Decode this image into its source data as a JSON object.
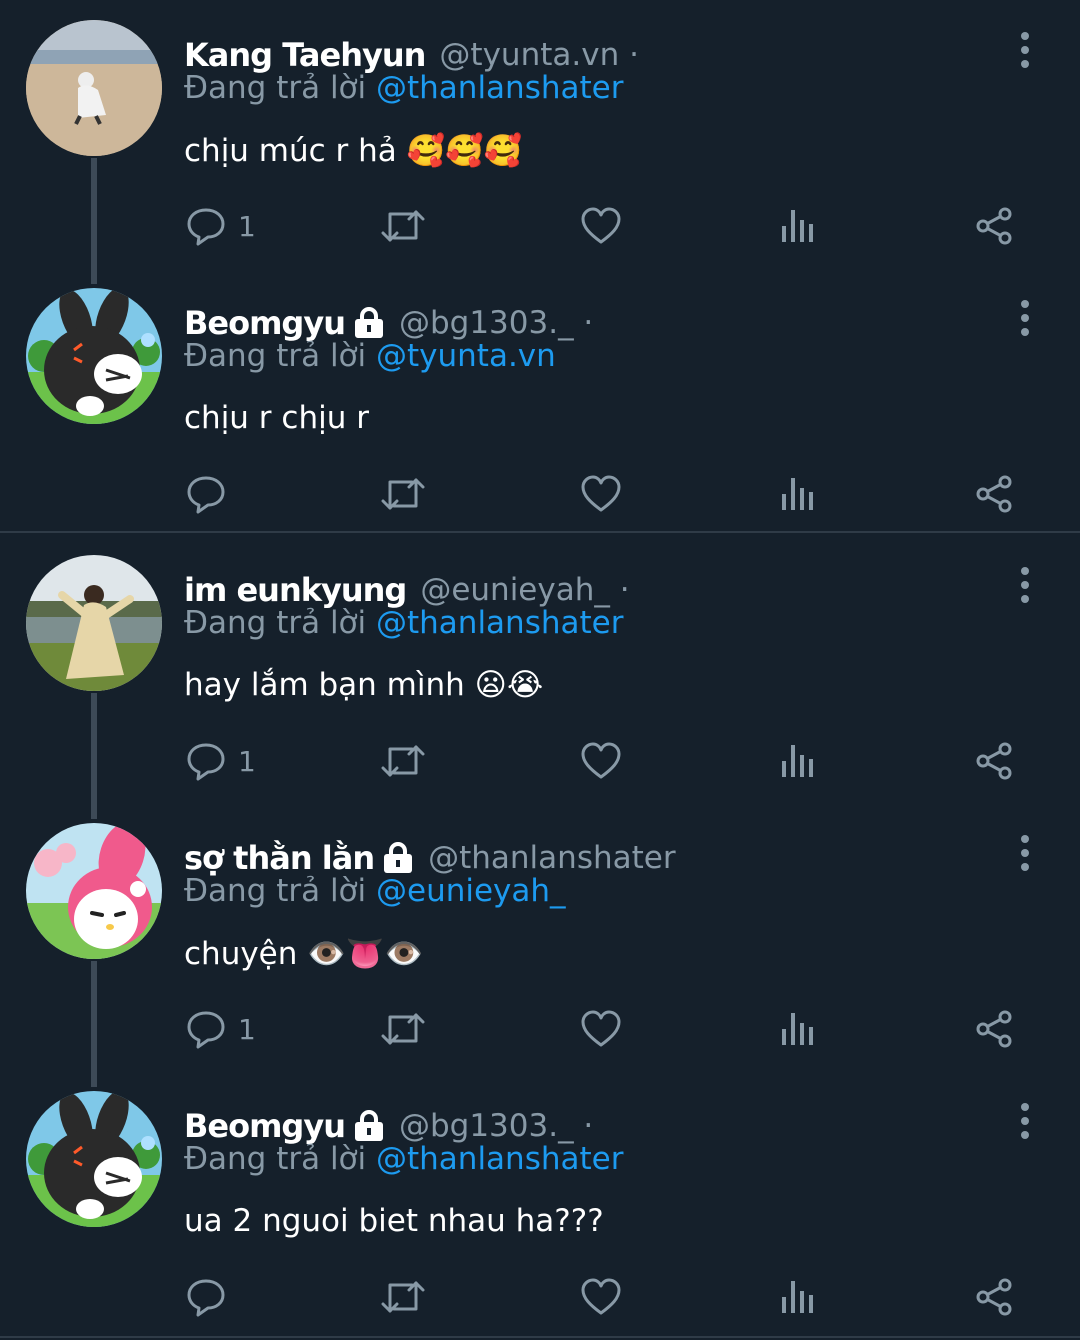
{
  "replies_label": "Đang trả lời",
  "tweets": [
    {
      "name": "Kang Taehyun",
      "locked": false,
      "handle": "@tyunta.vn ·",
      "reply_to": "@thanlanshater",
      "text": "chịu múc r hả 🥰🥰🥰",
      "reply_count": "1",
      "avatar": "beach-photo"
    },
    {
      "name": "Beomgyu",
      "locked": true,
      "handle": "@bg1303._ ·",
      "reply_to": "@tyunta.vn",
      "text": "chịu r chịu r",
      "reply_count": "",
      "avatar": "angry-cartoon-bunny"
    },
    {
      "name": "im eunkyung",
      "locked": false,
      "handle": "@eunieyah_ ·",
      "reply_to": "@thanlanshater",
      "text": "hay lắm bạn mình 😦😭",
      "reply_count": "1",
      "avatar": "field-photo"
    },
    {
      "name": "sợ thằn lằn",
      "locked": true,
      "handle": "@thanlanshater",
      "reply_to": "@eunieyah_",
      "text": "chuyện 👁️👅👁️",
      "reply_count": "1",
      "avatar": "my-melody-cartoon"
    },
    {
      "name": "Beomgyu",
      "locked": true,
      "handle": "@bg1303._ ·",
      "reply_to": "@thanlanshater",
      "text": "ua 2 nguoi biet nhau ha???",
      "reply_count": "",
      "avatar": "angry-cartoon-bunny"
    }
  ],
  "icons": {
    "reply": "reply-icon",
    "retweet": "retweet-icon",
    "like": "like-icon",
    "views": "views-icon",
    "share": "share-icon",
    "more": "more-icon",
    "lock": "lock-icon"
  },
  "colors": {
    "background": "#15202b",
    "muted": "#8899a6",
    "accent": "#1d9bf0"
  }
}
